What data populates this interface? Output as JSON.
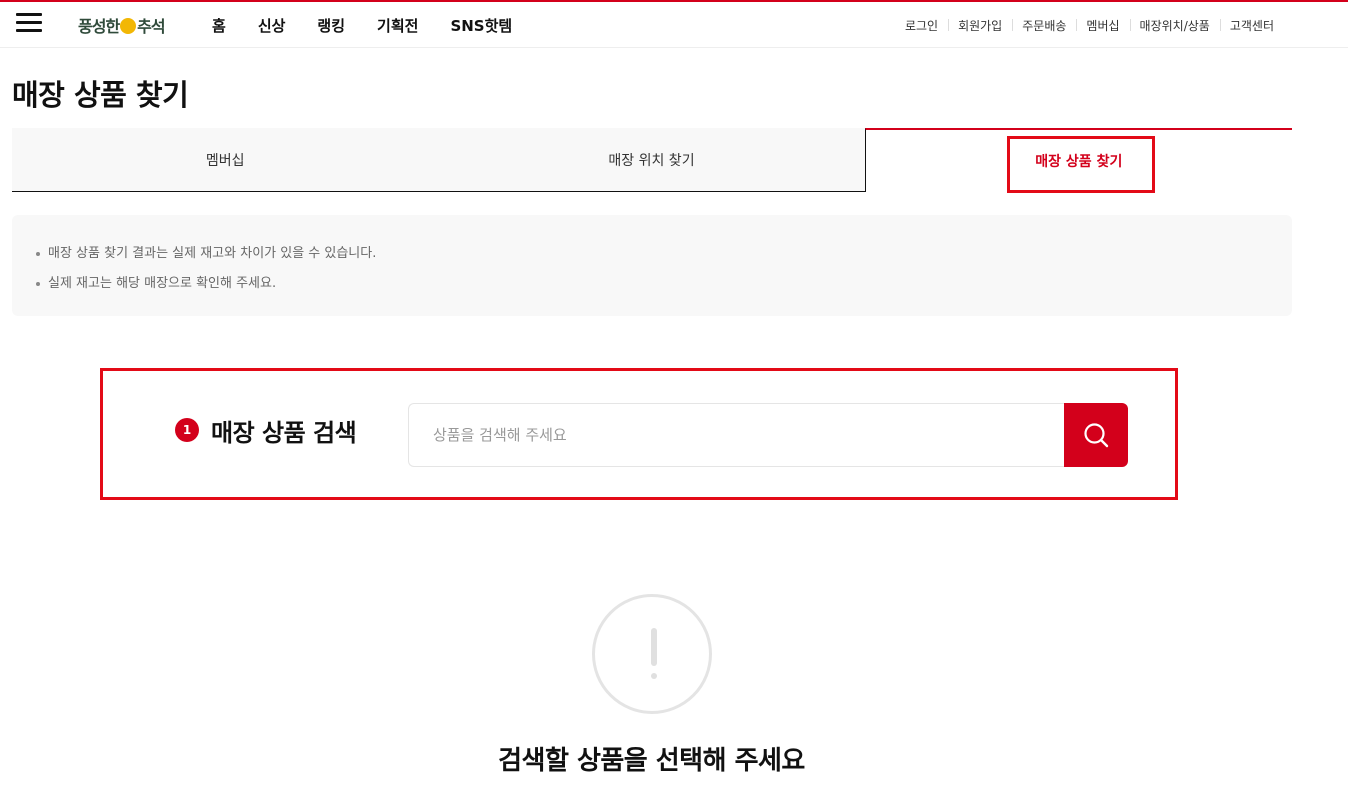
{
  "header": {
    "logo_left": "풍성한",
    "logo_right": "추석",
    "gnb": [
      "홈",
      "신상",
      "랭킹",
      "기획전",
      "SNS핫템"
    ],
    "util": [
      "로그인",
      "회원가입",
      "주문배송",
      "멤버십",
      "매장위치/상품",
      "고객센터"
    ]
  },
  "page": {
    "title": "매장 상품 찾기"
  },
  "tabs": [
    {
      "label": "멤버십",
      "active": false
    },
    {
      "label": "매장 위치 찾기",
      "active": false
    },
    {
      "label": "매장 상품 찾기",
      "active": true
    }
  ],
  "notice": [
    "매장 상품 찾기 결과는 실제 재고와 차이가 있을 수 있습니다.",
    "실제 재고는 해당 매장으로 확인해 주세요."
  ],
  "search": {
    "step": "1",
    "label": "매장 상품 검색",
    "placeholder": "상품을 검색해 주세요",
    "value": ""
  },
  "empty": {
    "message": "검색할 상품을 선택해 주세요"
  },
  "colors": {
    "accent": "#d3001b",
    "highlight": "#e30a17"
  }
}
